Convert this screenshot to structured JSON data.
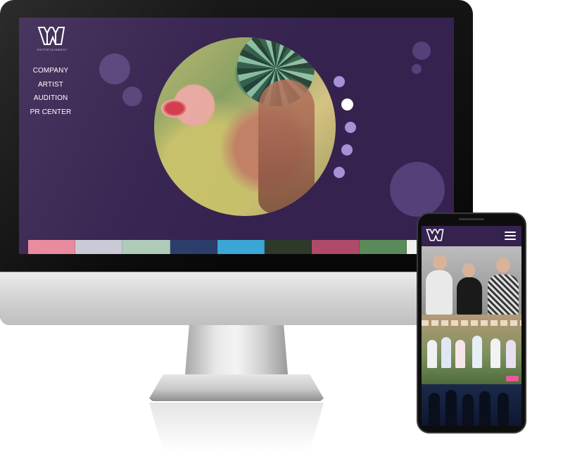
{
  "brand": {
    "logo_text": "ENTERTAINMENT"
  },
  "desktop": {
    "nav": [
      "COMPANY",
      "ARTIST",
      "AUDITION",
      "PR CENTER"
    ],
    "slider_dots": 5,
    "active_dot": 1,
    "thumbnails": [
      {
        "color": "#e8879a"
      },
      {
        "color": "#c9c9d6"
      },
      {
        "color": "#aecbb8"
      },
      {
        "color": "#2c3c6a"
      },
      {
        "color": "#3aa7d6"
      },
      {
        "color": "#2d3a2a"
      },
      {
        "color": "#b14a6a"
      },
      {
        "color": "#5a8a5a"
      },
      {
        "color": "#efefef"
      }
    ]
  },
  "colors": {
    "site_background": "#35224f",
    "dot": "#a892d6",
    "dot_active": "#ffffff"
  }
}
